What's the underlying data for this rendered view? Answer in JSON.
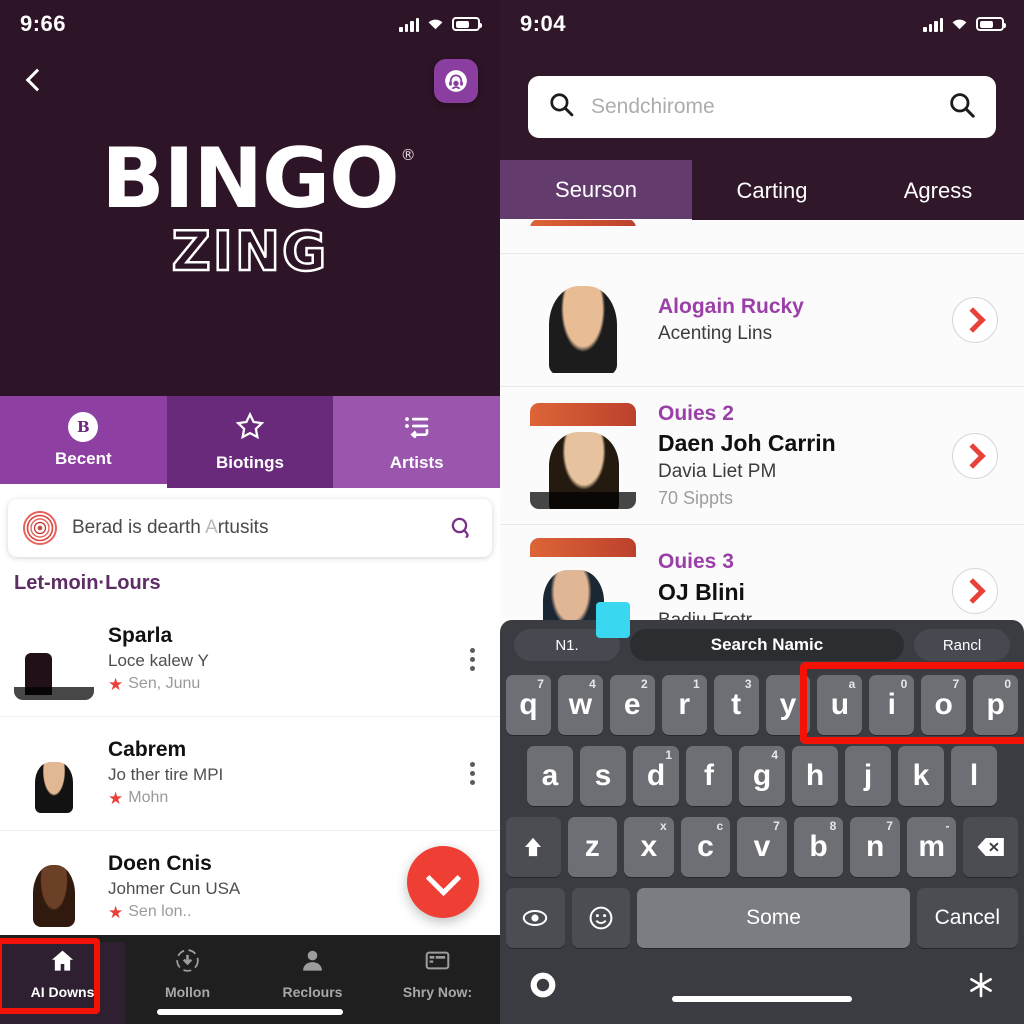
{
  "left_phone": {
    "status_bar": {
      "time": "9:66",
      "icons": [
        "signal-icon",
        "wifi-icon",
        "battery-icon"
      ]
    },
    "hero": {
      "back_icon": "chevron-left-icon",
      "support_icon": "headphones-icon",
      "logo_main": "BINGO",
      "logo_registered": "®",
      "logo_sub": "ZING"
    },
    "tabs": [
      {
        "label": "Becent",
        "icon": "b-badge-icon",
        "selected": true
      },
      {
        "label": "Biotings",
        "icon": "star-outline-icon",
        "selected": false
      },
      {
        "label": "Artists",
        "icon": "list-reorder-icon",
        "selected": false
      }
    ],
    "search": {
      "leading_icon": "spiral-logo-icon",
      "value_prefix": "Berad is dearth ",
      "value_dim": "A",
      "value_suffix": "rtusits",
      "trailing_icon": "search-voice-icon"
    },
    "section_title": "Let-moin·Lours",
    "list": [
      {
        "title": "Sparla",
        "subtitle": "Loce kalew Y",
        "meta": "Sen, Junu",
        "menu_icon": "kebab-menu-icon",
        "thumb": "ph1"
      },
      {
        "title": "Cabrem",
        "subtitle": "Jo ther tire MPI",
        "meta": "Mohn",
        "menu_icon": "kebab-menu-icon",
        "thumb": "ph2"
      },
      {
        "title": "Doen Cnis",
        "subtitle": "Johmer Cun USA",
        "meta": "Sen lon..",
        "menu_icon": "kebab-menu-icon",
        "thumb": "ph3"
      }
    ],
    "fab": {
      "icon": "chevron-down-icon",
      "color": "#ef3e33"
    },
    "bottom_nav": [
      {
        "label": "AI Downs",
        "icon": "home-icon",
        "active": true
      },
      {
        "label": "Mollon",
        "icon": "refresh-circle-icon",
        "active": false
      },
      {
        "label": "Reclours",
        "icon": "person-icon",
        "active": false
      },
      {
        "label": "Shry Now:",
        "icon": "card-icon",
        "active": false
      }
    ],
    "annotation": "red-highlight-box"
  },
  "right_phone": {
    "status_bar": {
      "time": "9:04",
      "icons": [
        "signal-icon",
        "wifi-icon",
        "battery-icon"
      ]
    },
    "search": {
      "leading_icon": "search-icon",
      "placeholder": "Sendchirome",
      "trailing_icon": "search-icon"
    },
    "tabs": [
      {
        "label": "Seurson",
        "selected": true
      },
      {
        "label": "Carting",
        "selected": false
      },
      {
        "label": "Agress",
        "selected": false
      }
    ],
    "list": [
      {
        "kicker": "",
        "title": "",
        "subtitle": "",
        "meta": "",
        "thumb": "ph4",
        "clipped": true
      },
      {
        "kicker": "Alogain Rucky",
        "title": "",
        "subtitle": "Acenting Lins",
        "meta": "",
        "thumb": "ph5",
        "chev_icon": "chevron-right-icon"
      },
      {
        "kicker": "Ouies 2",
        "title": "Daen Joh Carrin",
        "subtitle": "Davia Liet PM",
        "meta": "70 Sippts",
        "thumb": "ph6",
        "chev_icon": "chevron-right-icon"
      },
      {
        "kicker": "Ouies 3",
        "title": "OJ Blini",
        "subtitle": "Badiu Frotr",
        "meta": "",
        "thumb": "ph7",
        "chev_icon": "chevron-right-icon"
      }
    ],
    "keyboard": {
      "suggestions": [
        {
          "label": "N1.",
          "kind": "side"
        },
        {
          "label": "Search Namic",
          "kind": "center"
        },
        {
          "label": "Rancl",
          "kind": "side"
        }
      ],
      "row1": [
        {
          "key": "q",
          "sup": "7"
        },
        {
          "key": "w",
          "sup": "4"
        },
        {
          "key": "e",
          "sup": "2"
        },
        {
          "key": "r",
          "sup": "1"
        },
        {
          "key": "t",
          "sup": "3"
        },
        {
          "key": "y",
          "sup": ""
        },
        {
          "key": "u",
          "sup": "a"
        },
        {
          "key": "i",
          "sup": "0"
        },
        {
          "key": "o",
          "sup": "7"
        },
        {
          "key": "p",
          "sup": "0"
        }
      ],
      "row2": [
        {
          "key": "a",
          "sup": ""
        },
        {
          "key": "s",
          "sup": ""
        },
        {
          "key": "d",
          "sup": "1"
        },
        {
          "key": "f",
          "sup": ""
        },
        {
          "key": "g",
          "sup": "4"
        },
        {
          "key": "h",
          "sup": ""
        },
        {
          "key": "j",
          "sup": ""
        },
        {
          "key": "k",
          "sup": ""
        },
        {
          "key": "l",
          "sup": ""
        }
      ],
      "row3": [
        {
          "key": "z",
          "sup": ""
        },
        {
          "key": "x",
          "sup": "x"
        },
        {
          "key": "c",
          "sup": "c"
        },
        {
          "key": "v",
          "sup": "7"
        },
        {
          "key": "b",
          "sup": "8"
        },
        {
          "key": "n",
          "sup": "7"
        },
        {
          "key": "m",
          "sup": "-"
        }
      ],
      "shift_icon": "shift-arrow-icon",
      "backspace_icon": "backspace-icon",
      "globe_icon": "globe-icon",
      "emoji_icon": "emoji-icon",
      "space_label": "Some",
      "cancel_label": "Cancel",
      "record_icon": "record-circle-icon",
      "snowflake_icon": "asterisk-icon"
    },
    "annotation": "red-highlight-box"
  },
  "colors": {
    "hero_bg": "#2d1426",
    "right_header_bg": "#30182a",
    "tab_selected": "#8d3fa2",
    "tab_mid": "#6a2a7c",
    "tab_right": "#9a56ac",
    "accent_purple": "#9b3fa8",
    "accent_red": "#ef3e33",
    "annotation_red": "#f41207",
    "nav_bg": "#201f20",
    "keyboard_bg": "#3a3c41",
    "key_bg": "#6d6f75"
  }
}
